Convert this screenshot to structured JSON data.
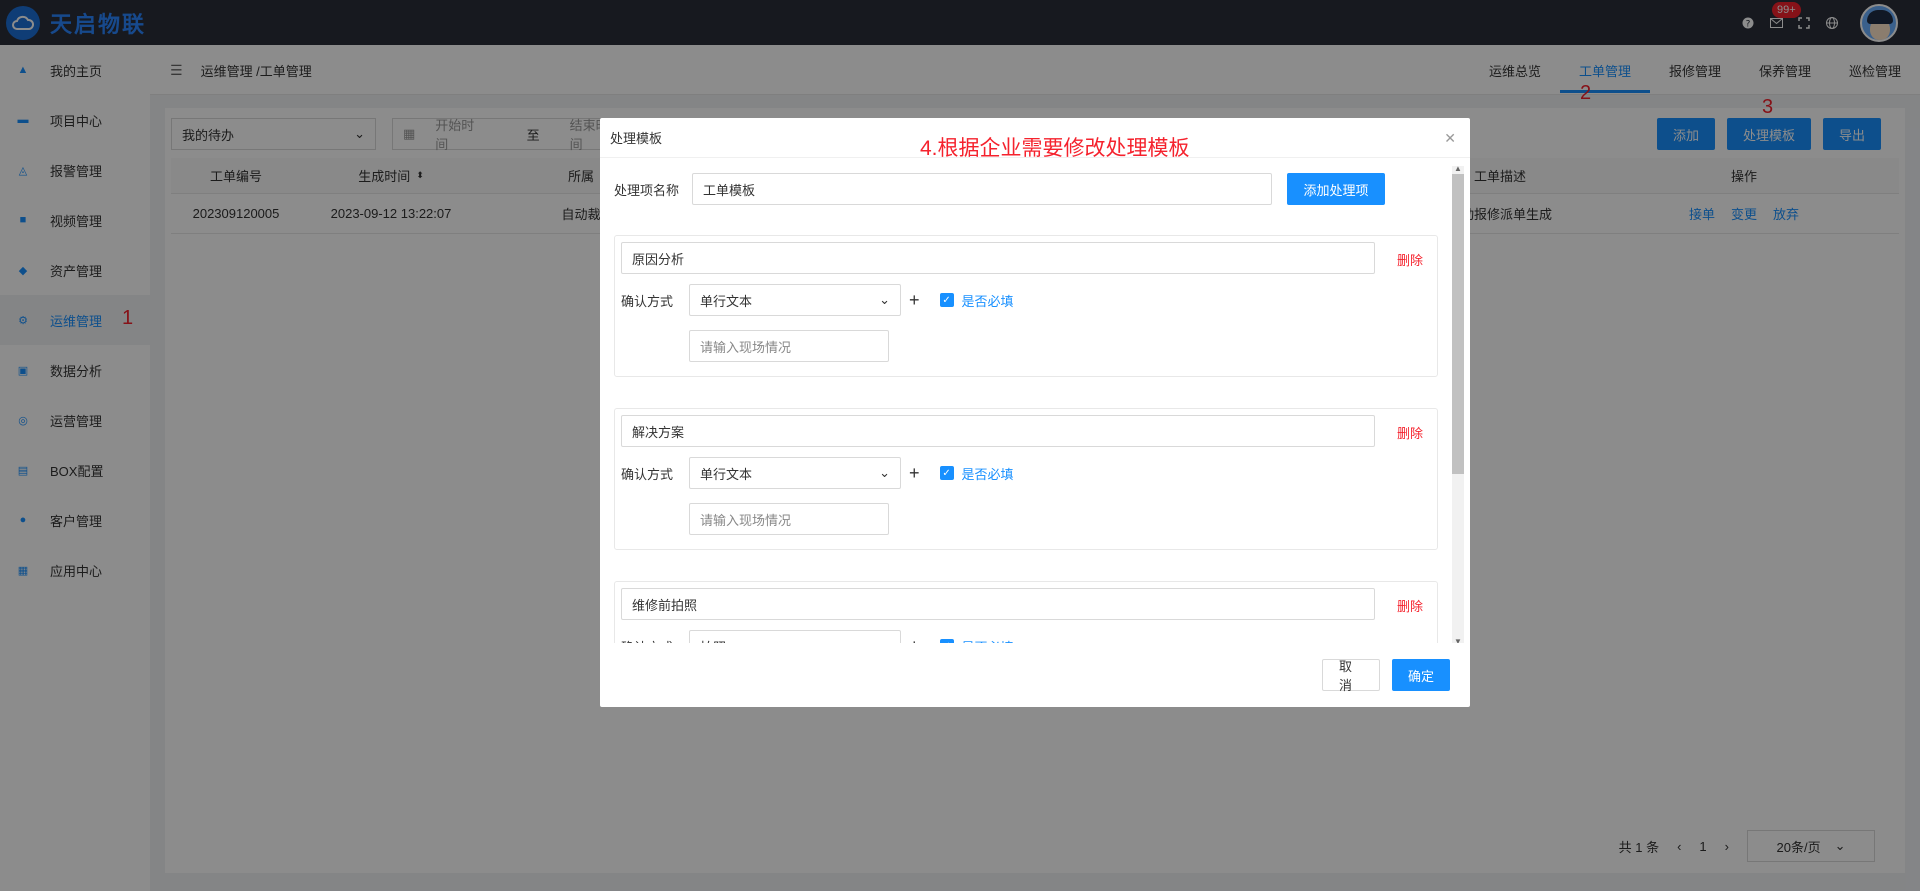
{
  "app": {
    "brand": "天启物联"
  },
  "topbar": {
    "badge": "99+",
    "icons": [
      "help-icon",
      "mail-icon",
      "fullscreen-icon",
      "globe-icon"
    ]
  },
  "sidebar": {
    "items": [
      {
        "label": "我的主页",
        "icon": "home-icon"
      },
      {
        "label": "项目中心",
        "icon": "project-icon"
      },
      {
        "label": "报警管理",
        "icon": "bell-icon"
      },
      {
        "label": "视频管理",
        "icon": "video-icon"
      },
      {
        "label": "资产管理",
        "icon": "asset-icon"
      },
      {
        "label": "运维管理",
        "icon": "gear-icon",
        "active": true
      },
      {
        "label": "数据分析",
        "icon": "chart-icon"
      },
      {
        "label": "运营管理",
        "icon": "operation-icon"
      },
      {
        "label": "BOX配置",
        "icon": "box-icon"
      },
      {
        "label": "客户管理",
        "icon": "users-icon"
      },
      {
        "label": "应用中心",
        "icon": "apps-icon"
      }
    ]
  },
  "annotations": {
    "a1": "1",
    "a2": "2",
    "a3": "3",
    "modal": "4.根据企业需要修改处理模板"
  },
  "header": {
    "breadcrumb": "运维管理 /工单管理",
    "nav": [
      "运维总览",
      "工单管理",
      "报修管理",
      "保养管理",
      "巡检管理"
    ],
    "active_nav": "工单管理"
  },
  "toolbar": {
    "filter_select": "我的待办",
    "start_placeholder": "开始时间",
    "range_sep": "至",
    "end_placeholder": "结束时间",
    "add": "添加",
    "template": "处理模板",
    "export": "导出"
  },
  "table": {
    "columns": [
      "工单编号",
      "生成时间",
      "所属",
      "工单描述",
      "操作"
    ],
    "rows": [
      {
        "id": "202309120005",
        "time": "2023-09-12 13:22:07",
        "owner": "自动裁",
        "desc": "手动报修派单生成",
        "ops": [
          "接单",
          "变更",
          "放弃"
        ]
      }
    ]
  },
  "pager": {
    "total": "共 1 条",
    "page": "1",
    "size": "20条/页"
  },
  "modal": {
    "title": "处理模板",
    "name_label": "处理项名称",
    "name_value": "工单模板",
    "add_item": "添加处理项",
    "confirm_label": "确认方式",
    "required_label": "是否必填",
    "delete_label": "删除",
    "items": [
      {
        "title": "原因分析",
        "method": "单行文本",
        "placeholder": "请输入现场情况"
      },
      {
        "title": "解决方案",
        "method": "单行文本",
        "placeholder": "请输入现场情况"
      },
      {
        "title": "维修前拍照",
        "method": "拍照",
        "placeholder": ""
      }
    ],
    "cancel": "取消",
    "ok": "确定"
  }
}
